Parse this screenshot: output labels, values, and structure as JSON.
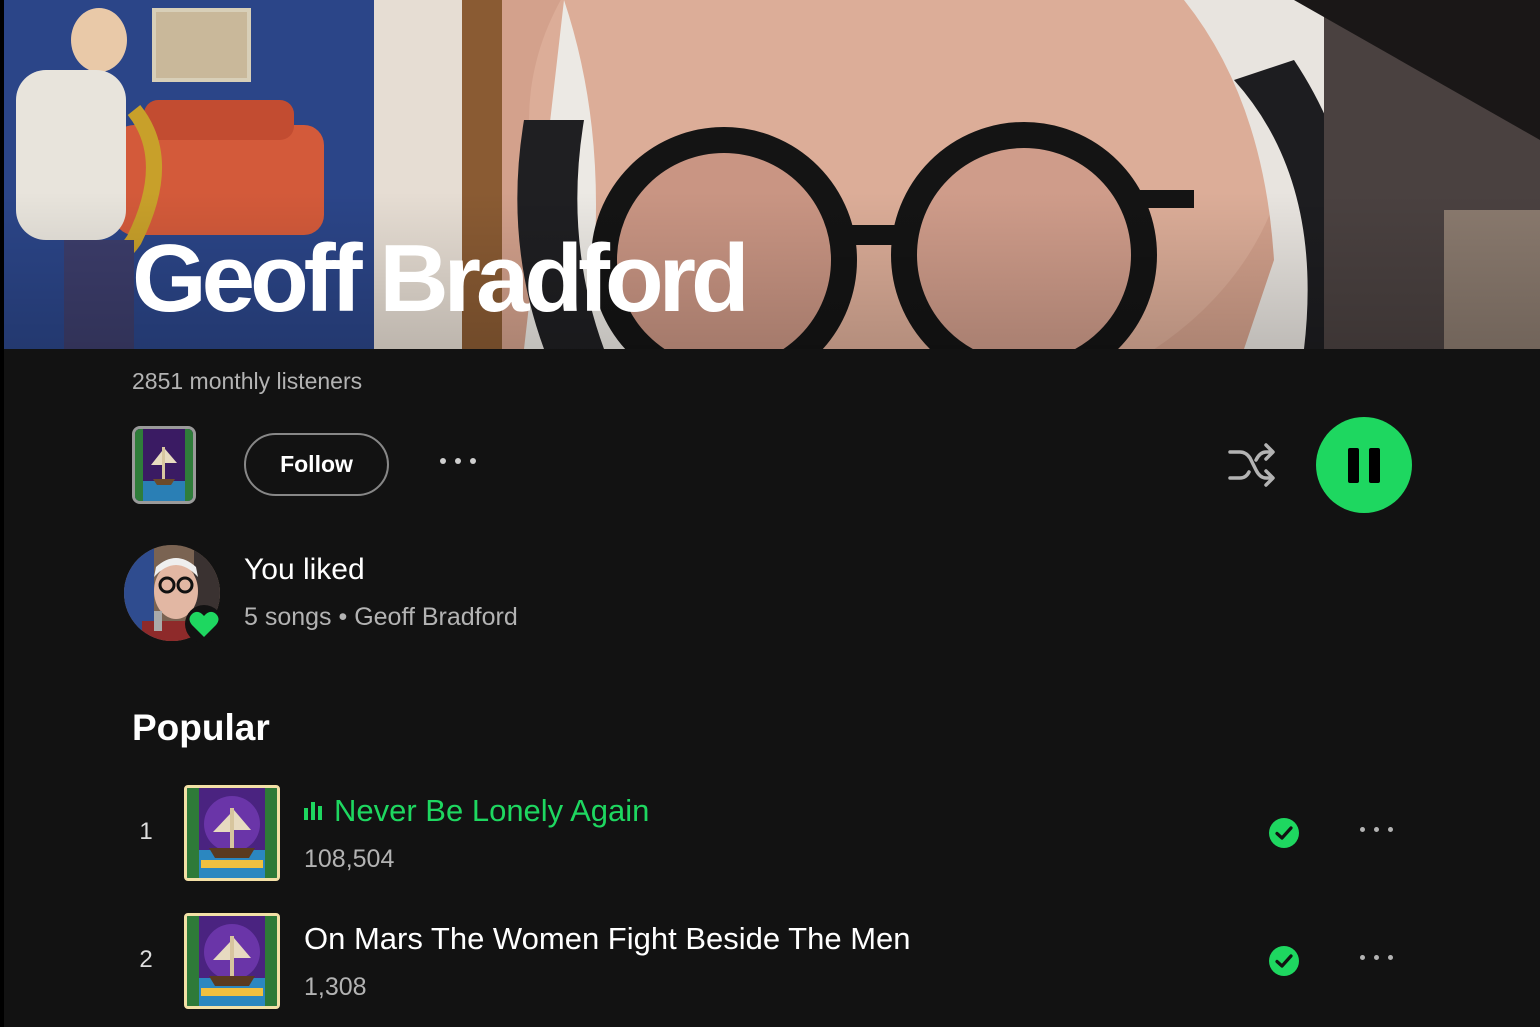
{
  "artist": {
    "name": "Geoff Bradford",
    "monthly_listeners": "2851 monthly listeners"
  },
  "actions": {
    "follow_label": "Follow",
    "more_icon": "more-horizontal-icon",
    "shuffle_icon": "shuffle-icon",
    "play_state": "pause-icon"
  },
  "liked": {
    "title": "You liked",
    "subtitle": "5 songs • Geoff Bradford"
  },
  "popular": {
    "heading": "Popular",
    "tracks": [
      {
        "number": "1",
        "title": "Never Be Lonely Again",
        "plays": "108,504",
        "playing": true
      },
      {
        "number": "2",
        "title": "On Mars The Women Fight Beside The Men",
        "plays": "1,308",
        "playing": false
      }
    ]
  },
  "colors": {
    "accent": "#1ed760",
    "background": "#121212",
    "secondary_text": "#b3b3b3"
  }
}
